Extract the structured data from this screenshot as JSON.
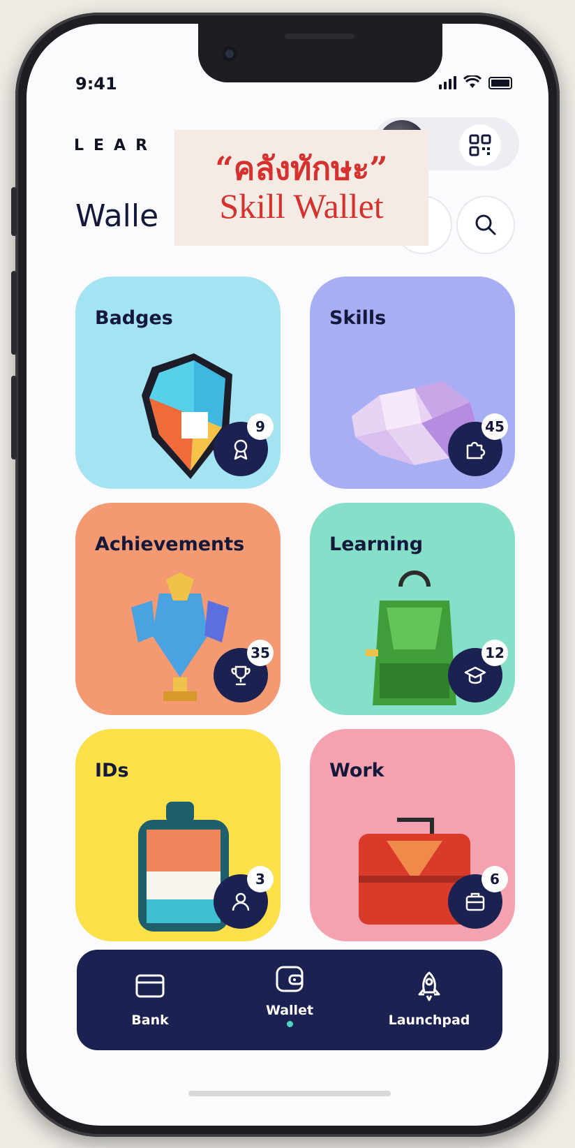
{
  "status": {
    "time": "9:41"
  },
  "header": {
    "logo_text": "LEAR",
    "page_title": "Walle"
  },
  "overlay": {
    "thai_title": "“คลังทักษะ”",
    "english_title": "Skill Wallet"
  },
  "cards": [
    {
      "title": "Badges",
      "count": "9",
      "bg": "#a3e3f2",
      "icon": "ribbon-icon"
    },
    {
      "title": "Skills",
      "count": "45",
      "bg": "#a7aef4",
      "icon": "puzzle-icon"
    },
    {
      "title": "Achievements",
      "count": "35",
      "bg": "#f49a72",
      "icon": "trophy-icon"
    },
    {
      "title": "Learning",
      "count": "12",
      "bg": "#86dfc8",
      "icon": "graduation-cap-icon"
    },
    {
      "title": "IDs",
      "count": "3",
      "bg": "#fbe04a",
      "icon": "user-icon"
    },
    {
      "title": "Work",
      "count": "6",
      "bg": "#f4a2b0",
      "icon": "briefcase-icon"
    }
  ],
  "nav": [
    {
      "label": "Bank",
      "icon": "card-icon",
      "active": false
    },
    {
      "label": "Wallet",
      "icon": "wallet-icon",
      "active": true
    },
    {
      "label": "Launchpad",
      "icon": "rocket-icon",
      "active": false
    }
  ],
  "colors": {
    "navy": "#1b2150",
    "accent": "#4fd6c2",
    "overlay_red": "#d4312f"
  }
}
